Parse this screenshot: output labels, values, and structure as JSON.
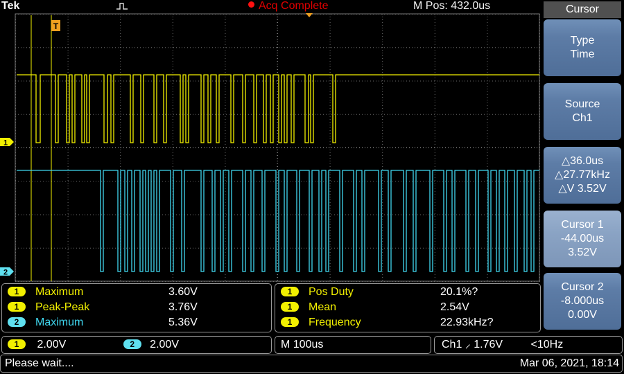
{
  "topbar": {
    "brand": "Tek",
    "acquisition_status": "Acq Complete",
    "horizontal_position": "M Pos: 432.0us",
    "trigger_marker": "T",
    "ch1_marker": "1",
    "ch2_marker": "2"
  },
  "menu": {
    "title": "Cursor",
    "buttons": [
      {
        "lines": [
          "Type",
          "Time"
        ]
      },
      {
        "lines": [
          "Source",
          "Ch1"
        ]
      },
      {
        "lines": [
          "△36.0us",
          "△27.77kHz",
          "△V 3.52V"
        ]
      },
      {
        "lines": [
          "Cursor 1",
          "-44.00us",
          "3.52V"
        ]
      },
      {
        "lines": [
          "Cursor 2",
          "-8.000us",
          "0.00V"
        ]
      }
    ]
  },
  "measurements": {
    "left": [
      {
        "channel": "1",
        "name": "Maximum",
        "value": "3.60V"
      },
      {
        "channel": "1",
        "name": "Peak-Peak",
        "value": "3.76V"
      },
      {
        "channel": "2",
        "name": "Maximum",
        "value": "5.36V"
      }
    ],
    "right": [
      {
        "channel": "1",
        "name": "Pos Duty",
        "value": "20.1%?"
      },
      {
        "channel": "1",
        "name": "Mean",
        "value": "2.54V"
      },
      {
        "channel": "1",
        "name": "Frequency",
        "value": "22.93kHz?"
      }
    ]
  },
  "scales": {
    "ch1_label": "1",
    "ch1_scale": "2.00V",
    "ch2_label": "2",
    "ch2_scale": "2.00V",
    "timebase": "M 100us",
    "trigger": "Ch1 ⸝ 1.76V",
    "trigger_freq": "<10Hz"
  },
  "status": {
    "message": "Please wait....",
    "datetime": "Mar 06, 2021, 18:14"
  },
  "colors": {
    "ch1": "#f2f000",
    "ch2": "#40d8f0",
    "trigger_marker": "#f0a020",
    "acq_status": "#e00000",
    "menu_button": "#5d7ca6",
    "menu_button_selected": "#8aa3c4"
  },
  "icons": [
    "trigger-pulse-icon",
    "acq-status-dot-icon",
    "trigger-rising-edge-icon"
  ]
}
